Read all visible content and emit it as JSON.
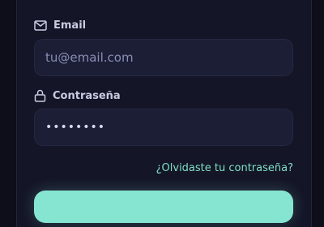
{
  "form": {
    "email": {
      "icon": "mail-icon",
      "label": "Email",
      "placeholder": "tu@email.com"
    },
    "password": {
      "icon": "lock-icon",
      "label": "Contraseña",
      "value": "••••••••"
    },
    "forgot_link": "¿Olvidaste tu contraseña?"
  },
  "colors": {
    "background": "#0d0e1a",
    "card": "#141527",
    "input_bg": "#1c1e36",
    "accent": "#7ee0c8"
  }
}
